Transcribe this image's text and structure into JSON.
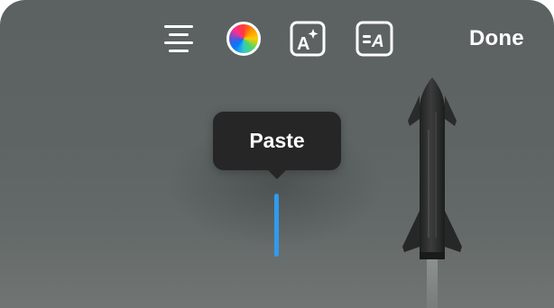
{
  "toolbar": {
    "align_icon": "text-align-center-icon",
    "color_icon": "color-wheel-icon",
    "effect_icon": "text-effect-sparkle-icon",
    "style_icon": "text-background-style-icon",
    "done_label": "Done"
  },
  "edit_menu": {
    "paste_label": "Paste"
  },
  "colors": {
    "background": "#5e6464",
    "menu": "#262626",
    "caret": "#2f9bf0",
    "text": "#ffffff"
  }
}
